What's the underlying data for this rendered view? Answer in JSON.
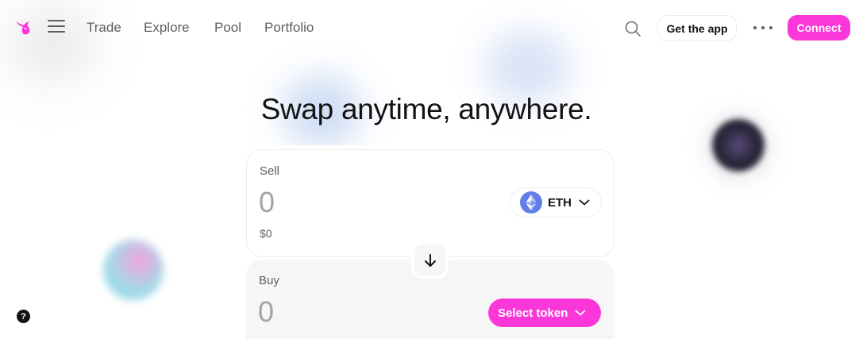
{
  "nav": {
    "links": [
      "Trade",
      "Explore",
      "Pool",
      "Portfolio"
    ],
    "get_app_label": "Get the app",
    "connect_label": "Connect"
  },
  "hero": {
    "title": "Swap anytime, anywhere."
  },
  "swap": {
    "sell": {
      "label": "Sell",
      "amount_placeholder": "0",
      "usd_value": "$0",
      "token_symbol": "ETH",
      "token_icon": "eth-icon"
    },
    "buy": {
      "label": "Buy",
      "amount_placeholder": "0",
      "select_token_label": "Select token"
    },
    "switch_icon": "arrow-down-icon"
  },
  "help": {
    "label": "?"
  },
  "colors": {
    "accent": "#fc37d9",
    "text_primary": "#131313",
    "text_secondary": "#5e5e5e",
    "eth_blue": "#627eea",
    "panel_bg": "#f6f6f6"
  }
}
